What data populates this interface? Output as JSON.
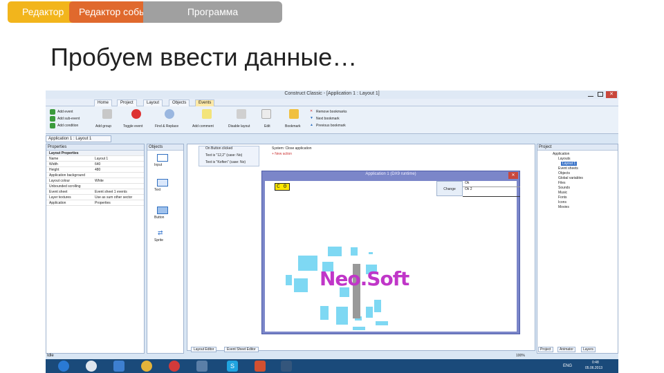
{
  "slide": {
    "tabs": [
      "Редактор",
      "Редактор событий",
      "Программа"
    ],
    "title": "Пробуем ввести данные…"
  },
  "app": {
    "window_title": "Construct Classic - [Application 1 : Layout 1]",
    "ribbon_tabs": [
      "Home",
      "Project",
      "Layout",
      "Objects",
      "Events"
    ],
    "ribbon_buttons": [
      "Add event",
      "Add sub-event",
      "Add condition",
      "Add group",
      "Toggle event",
      "Find & Replace",
      "Add comment",
      "Disable layout",
      "Edit",
      "Bookmark",
      "Remove bookmarks",
      "Next bookmark",
      "Previous bookmark"
    ],
    "doc_tab": "Application 1 : Layout 1",
    "properties_title": "Properties",
    "properties_section": "Layout Properties",
    "properties": [
      {
        "k": "Name",
        "v": "Layout 1"
      },
      {
        "k": "Width",
        "v": "640"
      },
      {
        "k": "Height",
        "v": "480"
      },
      {
        "k": "Application background",
        "v": ""
      },
      {
        "k": "Layout colour",
        "v": "White"
      },
      {
        "k": "Unbounded scrolling",
        "v": ""
      },
      {
        "k": "Event sheet",
        "v": "Event sheet 1 events"
      },
      {
        "k": "Layer textures",
        "v": "Use as sum other sector"
      },
      {
        "k": "Application",
        "v": "Properties"
      }
    ],
    "objects_title": "Objects",
    "objects": [
      "Input",
      "Text",
      "Button",
      "Sprite"
    ],
    "events": [
      {
        "cond": "On Button clicked",
        "act": "System: Close application"
      },
      {
        "cond": "Text is \"12,2\" (case: No)",
        "act": "+ New action"
      },
      {
        "cond": "Text is \"Koften\" (case: No)",
        "act": ""
      }
    ],
    "project_title": "Project",
    "project_tree": [
      "Application",
      "Layouts",
      "Layout 1",
      "Event sheets",
      "Objects",
      "Global variables",
      "Files",
      "Sounds",
      "Music",
      "Fonts",
      "Icons",
      "Movies"
    ],
    "run_title": "Application 1 (DX9 runtime)",
    "run_list": [
      "Clicked",
      "Ok",
      "Ok 2"
    ],
    "run_button": "Change",
    "run_text": "C 0",
    "logo_text": "Neo.Soft",
    "bottom_tabs": [
      "Layout Editor",
      "Event Sheet Editor"
    ],
    "project_tabs": [
      "Project",
      "Animator",
      "Layers"
    ],
    "status_left": "Idle",
    "status_right": "100%",
    "clock_time": "0:48",
    "clock_date": "05.06.2013",
    "lang": "ENG"
  }
}
